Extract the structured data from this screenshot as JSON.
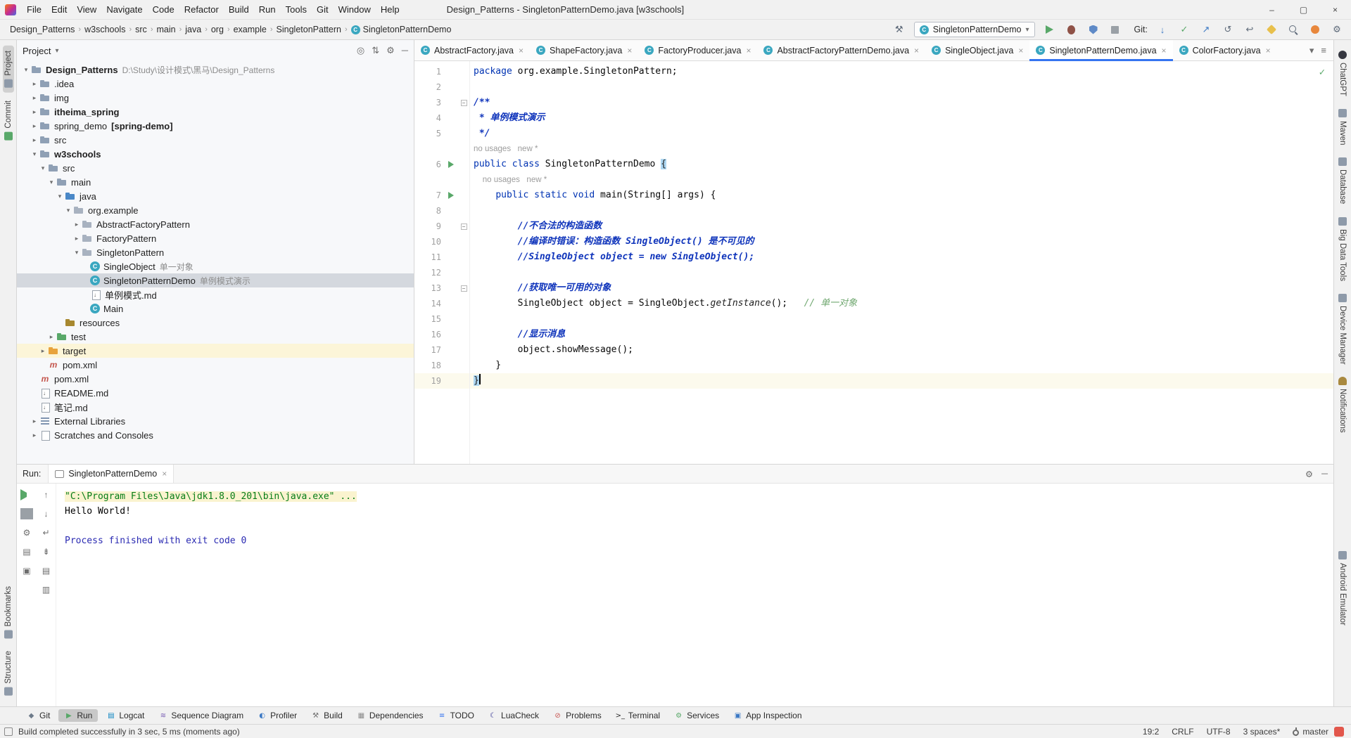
{
  "titlebar": {
    "menus": [
      "File",
      "Edit",
      "View",
      "Navigate",
      "Code",
      "Refactor",
      "Build",
      "Run",
      "Tools",
      "Git",
      "Window",
      "Help"
    ],
    "title": "Design_Patterns - SingletonPatternDemo.java [w3schools]"
  },
  "toolbar": {
    "breadcrumbs": [
      {
        "label": "Design_Patterns"
      },
      {
        "label": "w3schools"
      },
      {
        "label": "src"
      },
      {
        "label": "main"
      },
      {
        "label": "java"
      },
      {
        "label": "org"
      },
      {
        "label": "example"
      },
      {
        "label": "SingletonPattern"
      },
      {
        "label": "SingletonPatternDemo",
        "icon": "class"
      }
    ],
    "run_config": "SingletonPatternDemo",
    "git_label": "Git:"
  },
  "left_stripe": {
    "top": [
      {
        "label": "Project",
        "active": true
      },
      {
        "label": "Commit"
      }
    ],
    "bottom": [
      {
        "label": "Bookmarks"
      },
      {
        "label": "Structure"
      }
    ]
  },
  "right_stripe": {
    "top": [
      {
        "label": "ChatGPT"
      },
      {
        "label": "Maven"
      },
      {
        "label": "Database"
      },
      {
        "label": "Big Data Tools"
      },
      {
        "label": "Device Manager"
      },
      {
        "label": "Notifications"
      }
    ],
    "bottom": [
      {
        "label": "Android Emulator"
      }
    ]
  },
  "project": {
    "header": "Project",
    "tree": [
      {
        "depth": 0,
        "arrow": "open",
        "icon": "folder",
        "label": "Design_Patterns",
        "extra": "D:\\Study\\设计模式\\黑马\\Design_Patterns",
        "bold": true
      },
      {
        "depth": 1,
        "arrow": "closed",
        "icon": "folder",
        "label": ".idea"
      },
      {
        "depth": 1,
        "arrow": "closed",
        "icon": "folder",
        "label": "img"
      },
      {
        "depth": 1,
        "arrow": "closed",
        "icon": "folder",
        "label": "itheima_spring",
        "bold": true
      },
      {
        "depth": 1,
        "arrow": "closed",
        "icon": "folder",
        "label": "spring_demo",
        "extra": "[spring-demo]",
        "extra_style": "bold"
      },
      {
        "depth": 1,
        "arrow": "closed",
        "icon": "folder",
        "label": "src"
      },
      {
        "depth": 1,
        "arrow": "open",
        "icon": "folder",
        "label": "w3schools",
        "bold": true
      },
      {
        "depth": 2,
        "arrow": "open",
        "icon": "folder",
        "label": "src"
      },
      {
        "depth": 3,
        "arrow": "open",
        "icon": "folder",
        "label": "main"
      },
      {
        "depth": 4,
        "arrow": "open",
        "icon": "folder-src",
        "label": "java"
      },
      {
        "depth": 5,
        "arrow": "open",
        "icon": "package",
        "label": "org.example"
      },
      {
        "depth": 6,
        "arrow": "closed",
        "icon": "package",
        "label": "AbstractFactoryPattern"
      },
      {
        "depth": 6,
        "arrow": "closed",
        "icon": "package",
        "label": "FactoryPattern"
      },
      {
        "depth": 6,
        "arrow": "open",
        "icon": "package",
        "label": "SingletonPattern"
      },
      {
        "depth": 7,
        "arrow": "none",
        "icon": "class",
        "label": "SingleObject",
        "extra": "单一对象"
      },
      {
        "depth": 7,
        "arrow": "none",
        "icon": "class",
        "label": "SingletonPatternDemo",
        "extra": "单例模式演示",
        "selected": true
      },
      {
        "depth": 7,
        "arrow": "none",
        "icon": "md",
        "label": "单例模式.md"
      },
      {
        "depth": 7,
        "arrow": "none",
        "icon": "class",
        "label": "Main"
      },
      {
        "depth": 4,
        "arrow": "none",
        "icon": "folder-res",
        "label": "resources"
      },
      {
        "depth": 3,
        "arrow": "closed",
        "icon": "folder-test",
        "label": "test"
      },
      {
        "depth": 2,
        "arrow": "closed",
        "icon": "folder-excluded",
        "label": "target",
        "highlight": true
      },
      {
        "depth": 2,
        "arrow": "none",
        "icon": "maven",
        "label": "pom.xml"
      },
      {
        "depth": 1,
        "arrow": "none",
        "icon": "maven",
        "label": "pom.xml"
      },
      {
        "depth": 1,
        "arrow": "none",
        "icon": "md",
        "label": "README.md"
      },
      {
        "depth": 1,
        "arrow": "none",
        "icon": "md",
        "label": "笔记.md"
      },
      {
        "depth": 1,
        "arrow": "closed",
        "icon": "library",
        "label": "External Libraries"
      },
      {
        "depth": 1,
        "arrow": "closed",
        "icon": "scratch",
        "label": "Scratches and Consoles"
      }
    ]
  },
  "tabs": [
    {
      "label": "AbstractFactory.java"
    },
    {
      "label": "ShapeFactory.java"
    },
    {
      "label": "FactoryProducer.java"
    },
    {
      "label": "AbstractFactoryPatternDemo.java"
    },
    {
      "label": "SingleObject.java"
    },
    {
      "label": "SingletonPatternDemo.java",
      "active": true
    },
    {
      "label": "ColorFactory.java"
    }
  ],
  "editor": {
    "lines": [
      {
        "n": "1",
        "segs": [
          [
            "kw",
            "package"
          ],
          [
            "pl",
            " org.example.SingletonPattern;"
          ]
        ]
      },
      {
        "n": "2",
        "segs": []
      },
      {
        "n": "3",
        "fold": true,
        "segs": [
          [
            "cm",
            "/**"
          ]
        ]
      },
      {
        "n": "4",
        "segs": [
          [
            "cm",
            " * 单例模式演示"
          ]
        ]
      },
      {
        "n": "5",
        "segs": [
          [
            "cm",
            " */"
          ]
        ]
      },
      {
        "inlay": true,
        "segs": [
          [
            "hint",
            "no usages   new *"
          ]
        ]
      },
      {
        "n": "6",
        "run": true,
        "segs": [
          [
            "kw",
            "public"
          ],
          [
            "pl",
            " "
          ],
          [
            "kw",
            "class"
          ],
          [
            "pl",
            " SingletonPatternDemo "
          ],
          [
            "brace",
            "{"
          ]
        ]
      },
      {
        "inlay": true,
        "segs": [
          [
            "hint",
            "    no usages   new *"
          ]
        ]
      },
      {
        "n": "7",
        "run": true,
        "segs": [
          [
            "pl",
            "    "
          ],
          [
            "kw",
            "public"
          ],
          [
            "pl",
            " "
          ],
          [
            "kw",
            "static"
          ],
          [
            "pl",
            " "
          ],
          [
            "kw",
            "void"
          ],
          [
            "pl",
            " main("
          ],
          [
            "cls",
            "String"
          ],
          [
            "pl",
            "[] args) {"
          ]
        ]
      },
      {
        "n": "8",
        "segs": []
      },
      {
        "n": "9",
        "fold": true,
        "segs": [
          [
            "cm",
            "        //不合法的构造函数"
          ]
        ]
      },
      {
        "n": "10",
        "segs": [
          [
            "cm",
            "        //编译时错误：构造函数 SingleObject() 是不可见的"
          ]
        ]
      },
      {
        "n": "11",
        "segs": [
          [
            "cm",
            "        //SingleObject object = new SingleObject();"
          ]
        ]
      },
      {
        "n": "12",
        "segs": []
      },
      {
        "n": "13",
        "fold": true,
        "segs": [
          [
            "cm",
            "        //获取唯一可用的对象"
          ]
        ]
      },
      {
        "n": "14",
        "segs": [
          [
            "pl",
            "        SingleObject object = SingleObject."
          ],
          [
            "it",
            "getInstance"
          ],
          [
            "pl",
            "();   "
          ],
          [
            "gc",
            "// 单一对象"
          ]
        ]
      },
      {
        "n": "15",
        "segs": []
      },
      {
        "n": "16",
        "segs": [
          [
            "cm",
            "        //显示消息"
          ]
        ]
      },
      {
        "n": "17",
        "segs": [
          [
            "pl",
            "        object.showMessage();"
          ]
        ]
      },
      {
        "n": "18",
        "segs": [
          [
            "pl",
            "    }"
          ]
        ]
      },
      {
        "n": "19",
        "cur": true,
        "caret": true,
        "segs": [
          [
            "brace",
            "}"
          ]
        ]
      }
    ]
  },
  "run_panel": {
    "label": "Run:",
    "tab": "SingletonPatternDemo",
    "console": [
      {
        "segs": [
          [
            "cmd",
            "\"C:\\Program Files\\Java\\jdk1.8.0_201\\bin\\java.exe\" ..."
          ]
        ]
      },
      {
        "segs": [
          [
            "pl",
            "Hello World!"
          ]
        ]
      },
      {
        "segs": []
      },
      {
        "segs": [
          [
            "sys",
            "Process finished with exit code 0"
          ]
        ]
      }
    ]
  },
  "bottom_bar": {
    "items": [
      {
        "label": "Git"
      },
      {
        "label": "Run",
        "active": true
      },
      {
        "label": "Logcat"
      },
      {
        "label": "Sequence Diagram"
      },
      {
        "label": "Profiler"
      },
      {
        "label": "Build"
      },
      {
        "label": "Dependencies"
      },
      {
        "label": "TODO"
      },
      {
        "label": "LuaCheck"
      },
      {
        "label": "Problems"
      },
      {
        "label": "Terminal"
      },
      {
        "label": "Services"
      },
      {
        "label": "App Inspection"
      }
    ]
  },
  "status_bar": {
    "message": "Build completed successfully in 3 sec, 5 ms (moments ago)",
    "items": [
      {
        "label": "19:2",
        "name": "caret-position"
      },
      {
        "label": "CRLF",
        "name": "line-separator"
      },
      {
        "label": "UTF-8",
        "name": "file-encoding"
      },
      {
        "label": "3 spaces*",
        "name": "indent-style"
      },
      {
        "label": "master",
        "name": "git-branch"
      }
    ]
  }
}
